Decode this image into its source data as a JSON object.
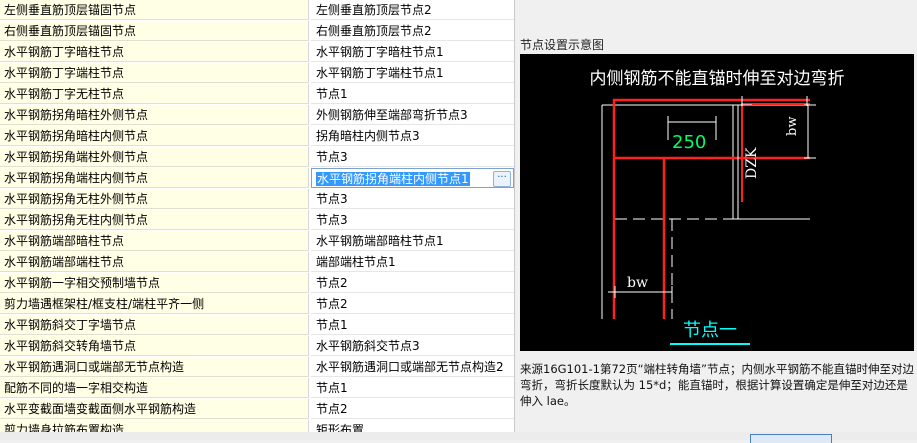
{
  "rows": [
    {
      "name": "左侧垂直筋顶层锚固节点",
      "value": "左侧垂直筋顶层节点2"
    },
    {
      "name": "右侧垂直筋顶层锚固节点",
      "value": "右侧垂直筋顶层节点2"
    },
    {
      "name": "水平钢筋丁字暗柱节点",
      "value": "水平钢筋丁字暗柱节点1"
    },
    {
      "name": "水平钢筋丁字端柱节点",
      "value": "水平钢筋丁字端柱节点1"
    },
    {
      "name": "水平钢筋丁字无柱节点",
      "value": "节点1"
    },
    {
      "name": "水平钢筋拐角暗柱外侧节点",
      "value": "外侧钢筋伸至端部弯折节点3"
    },
    {
      "name": "水平钢筋拐角暗柱内侧节点",
      "value": "拐角暗柱内侧节点3"
    },
    {
      "name": "水平钢筋拐角端柱外侧节点",
      "value": "节点3"
    },
    {
      "name": "水平钢筋拐角端柱内侧节点",
      "value": "水平钢筋拐角端柱内侧节点1",
      "editing": true
    },
    {
      "name": "水平钢筋拐角无柱外侧节点",
      "value": "节点3"
    },
    {
      "name": "水平钢筋拐角无柱内侧节点",
      "value": "节点3"
    },
    {
      "name": "水平钢筋端部暗柱节点",
      "value": "水平钢筋端部暗柱节点1"
    },
    {
      "name": "水平钢筋端部端柱节点",
      "value": "端部端柱节点1"
    },
    {
      "name": "水平钢筋一字相交预制墙节点",
      "value": "节点2"
    },
    {
      "name": "剪力墙遇框架柱/框支柱/端柱平齐一侧",
      "value": "节点2"
    },
    {
      "name": "水平钢筋斜交丁字墙节点",
      "value": "节点1"
    },
    {
      "name": "水平钢筋斜交转角墙节点",
      "value": "水平钢筋斜交节点3"
    },
    {
      "name": "水平钢筋遇洞口或端部无节点构造",
      "value": "水平钢筋遇洞口或端部无节点构造2"
    },
    {
      "name": "配筋不同的墙一字相交构造",
      "value": "节点1"
    },
    {
      "name": "水平变截面墙变截面侧水平钢筋构造",
      "value": "节点2"
    },
    {
      "name": "剪力墙身拉筋布置构造",
      "value": "矩形布置"
    }
  ],
  "ellipsis_label": "···",
  "diagram_panel": {
    "title": "节点设置示意图",
    "diagram_title": "内侧钢筋不能直锚时伸至对边弯折",
    "label_250": "250",
    "label_dzk": "DZK",
    "label_bw_top": "bw",
    "label_bw_bottom": "bw",
    "node_label": "节点一",
    "colors": {
      "rebar": "#ff2020",
      "dim": "#ffffff",
      "label_250": "#00ff60",
      "node_label": "#00ffff",
      "background": "#000000"
    }
  },
  "description": "来源16G101-1第72页“端柱转角墙”节点；内侧水平钢筋不能直锚时伸至对边弯折，弯折长度默认为 15*d；能直锚时，根据计算设置确定是伸至对边还是伸入 lae。"
}
